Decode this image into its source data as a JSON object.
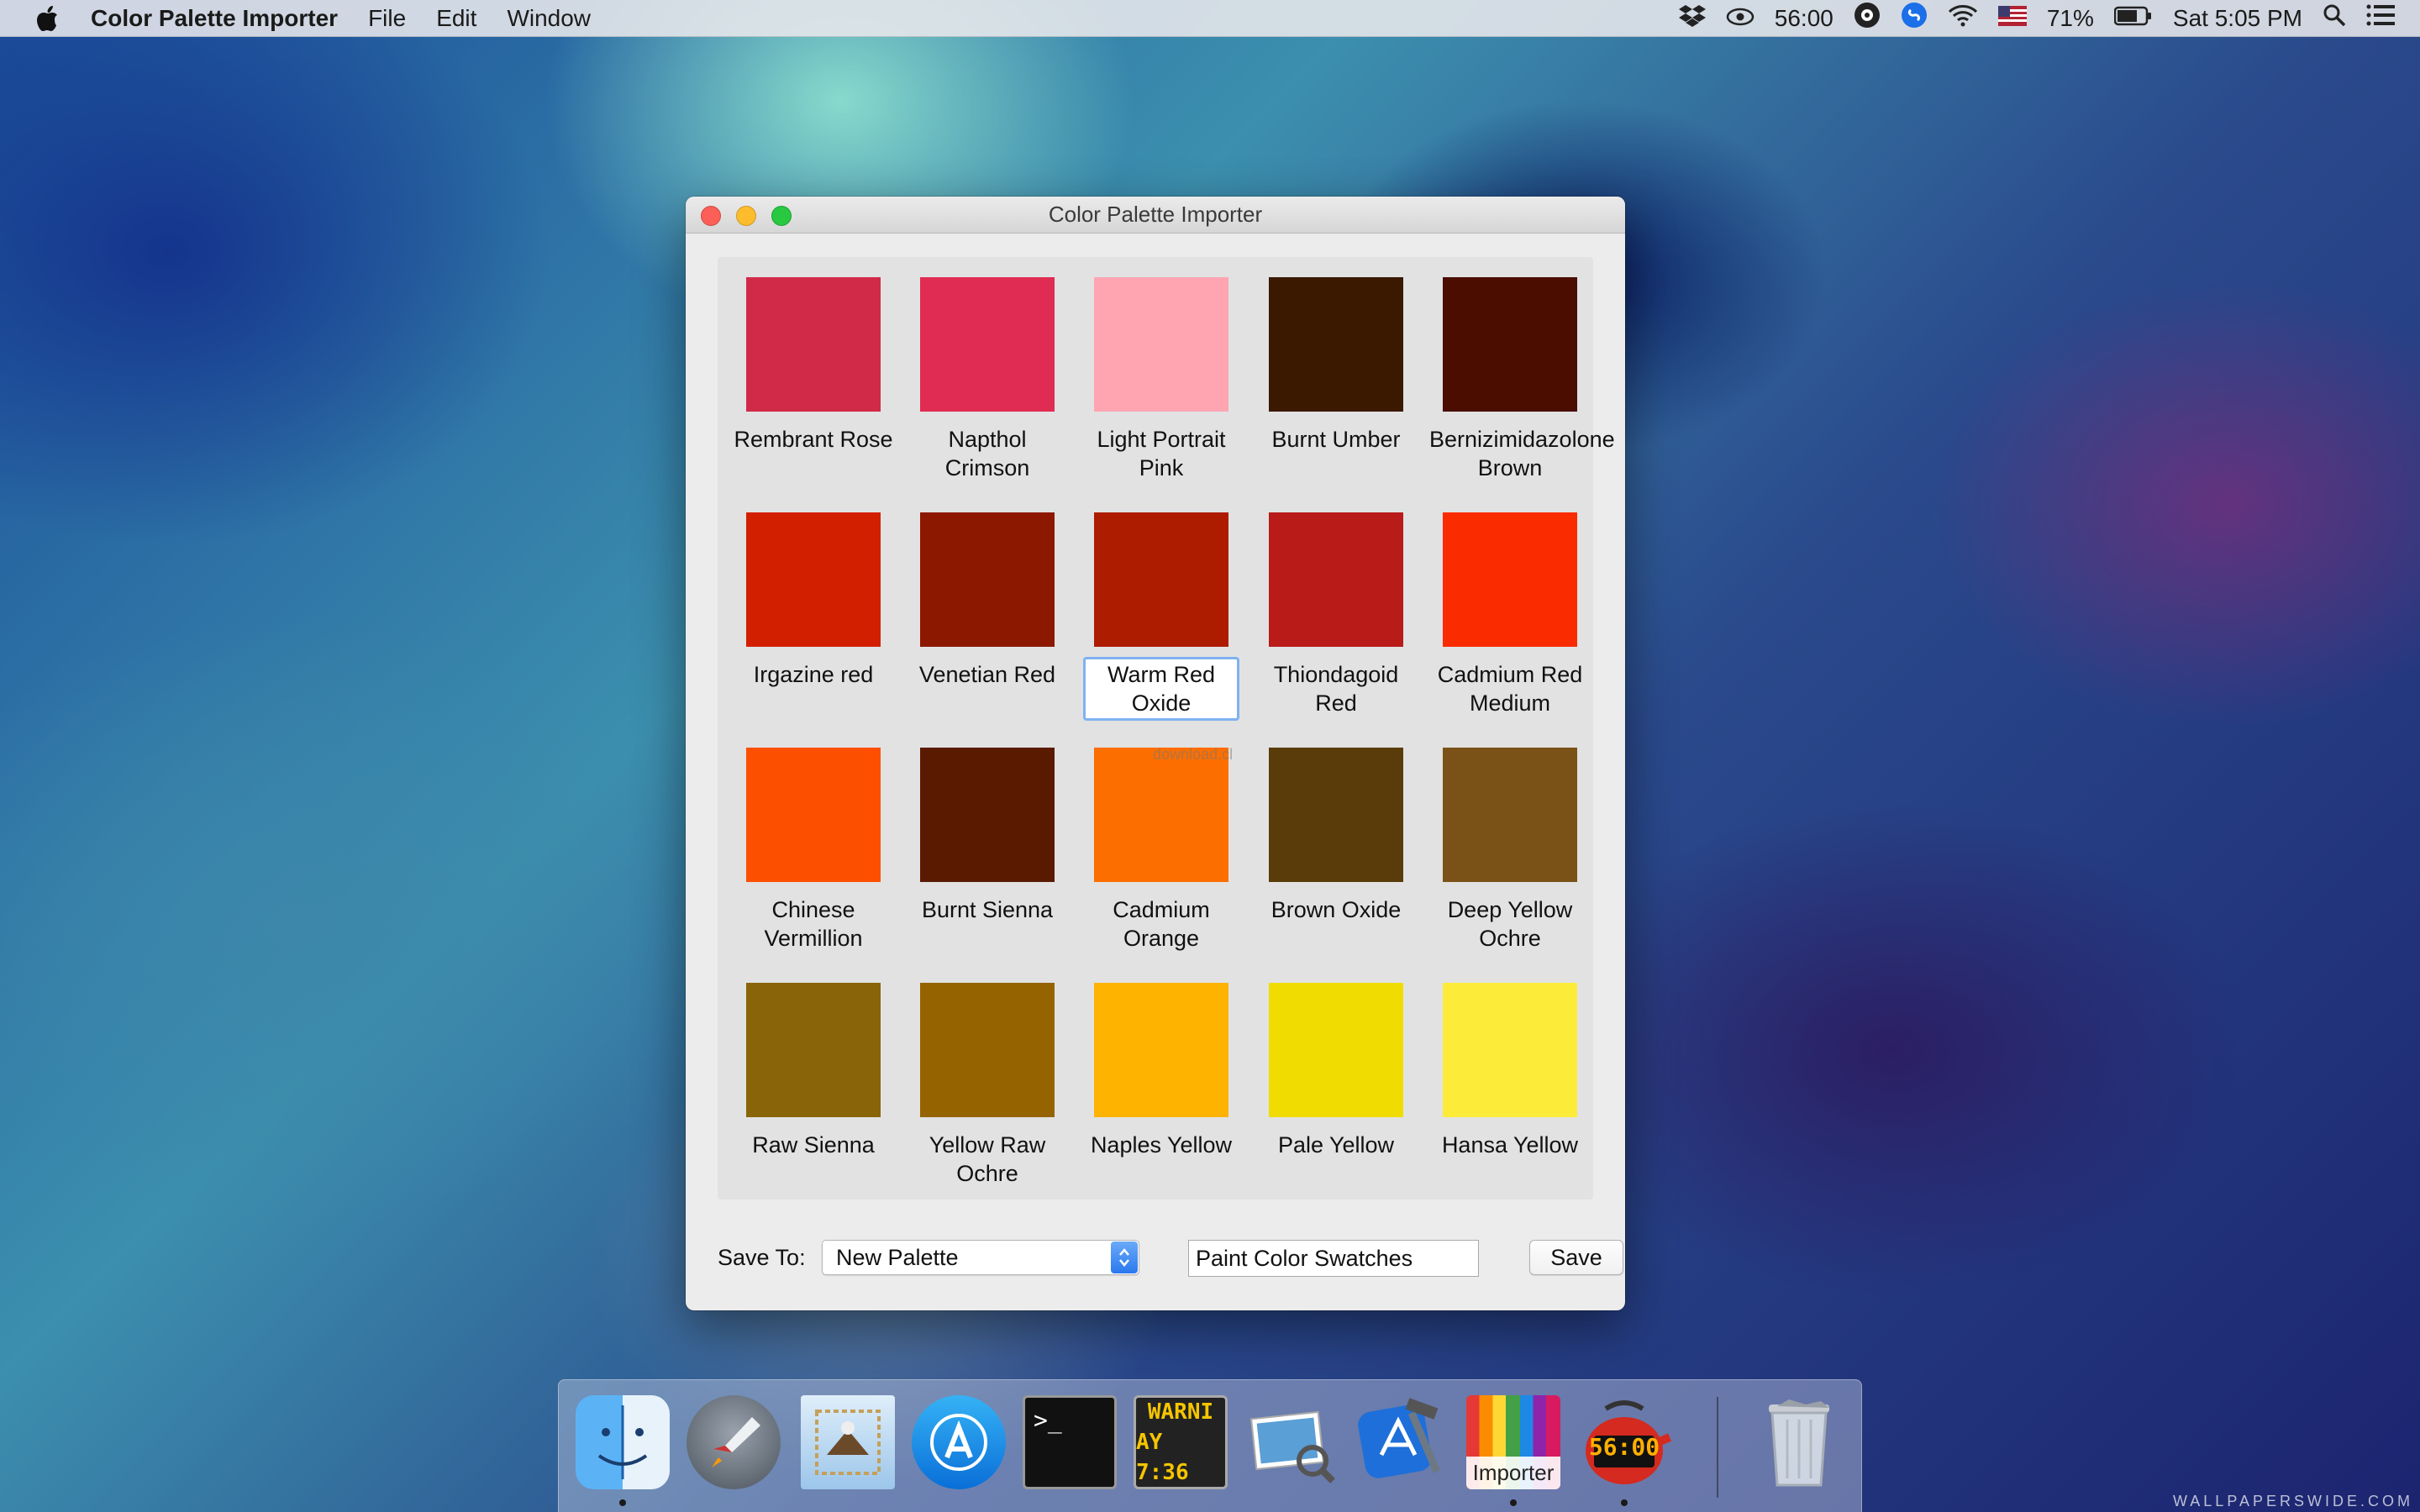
{
  "menubar": {
    "app_name": "Color Palette Importer",
    "menus": [
      "File",
      "Edit",
      "Window"
    ],
    "timer": "56:00",
    "battery": "71%",
    "clock": "Sat 5:05 PM"
  },
  "window": {
    "title": "Color Palette Importer",
    "swatches": [
      {
        "name": "Rembrant Rose",
        "color": "#d12a48"
      },
      {
        "name": "Napthol Crimson",
        "color": "#e02c52"
      },
      {
        "name": "Light Portrait Pink",
        "color": "#fea5b1"
      },
      {
        "name": "Burnt Umber",
        "color": "#3a1900"
      },
      {
        "name": "Bernizimidazolone Brown",
        "color": "#4a0d00"
      },
      {
        "name": "Irgazine red",
        "color": "#d21f00"
      },
      {
        "name": "Venetian Red",
        "color": "#8c1800"
      },
      {
        "name": "Warm Red Oxide",
        "color": "#ae1c00"
      },
      {
        "name": "Thiondagoid Red",
        "color": "#b81b18"
      },
      {
        "name": "Cadmium Red Medium",
        "color": "#fb2b00"
      },
      {
        "name": "Chinese Vermillion",
        "color": "#fd4f00"
      },
      {
        "name": "Burnt Sienna",
        "color": "#5a1a00"
      },
      {
        "name": "Cadmium Orange",
        "color": "#fc6e00"
      },
      {
        "name": "Brown Oxide",
        "color": "#5a3c0a"
      },
      {
        "name": "Deep Yellow Ochre",
        "color": "#7a5218"
      },
      {
        "name": "Raw Sienna",
        "color": "#8a6408"
      },
      {
        "name": "Yellow Raw Ochre",
        "color": "#956400"
      },
      {
        "name": "Naples Yellow",
        "color": "#feb300"
      },
      {
        "name": "Pale Yellow",
        "color": "#f0dc00"
      },
      {
        "name": "Hansa Yellow",
        "color": "#fdeb3a"
      }
    ],
    "selected_index": 7,
    "save_to_label": "Save To:",
    "save_to_value": "New Palette",
    "palette_name_value": "Paint Color Swatches",
    "save_button": "Save",
    "overlay_text": "download.cl"
  },
  "dock": {
    "items": [
      {
        "name": "Finder"
      },
      {
        "name": "Launchpad"
      },
      {
        "name": "Mail"
      },
      {
        "name": "App Store"
      },
      {
        "name": "Terminal",
        "text": ">_"
      },
      {
        "name": "Console",
        "text_line1": "WARNI",
        "text_line2": "AY 7:36"
      },
      {
        "name": "Preview"
      },
      {
        "name": "Xcode"
      },
      {
        "name": "Importer",
        "text": "Importer"
      },
      {
        "name": "Timer",
        "text": "56:00"
      },
      {
        "name": "Trash"
      }
    ]
  },
  "watermark": "WALLPAPERSWIDE.COM"
}
